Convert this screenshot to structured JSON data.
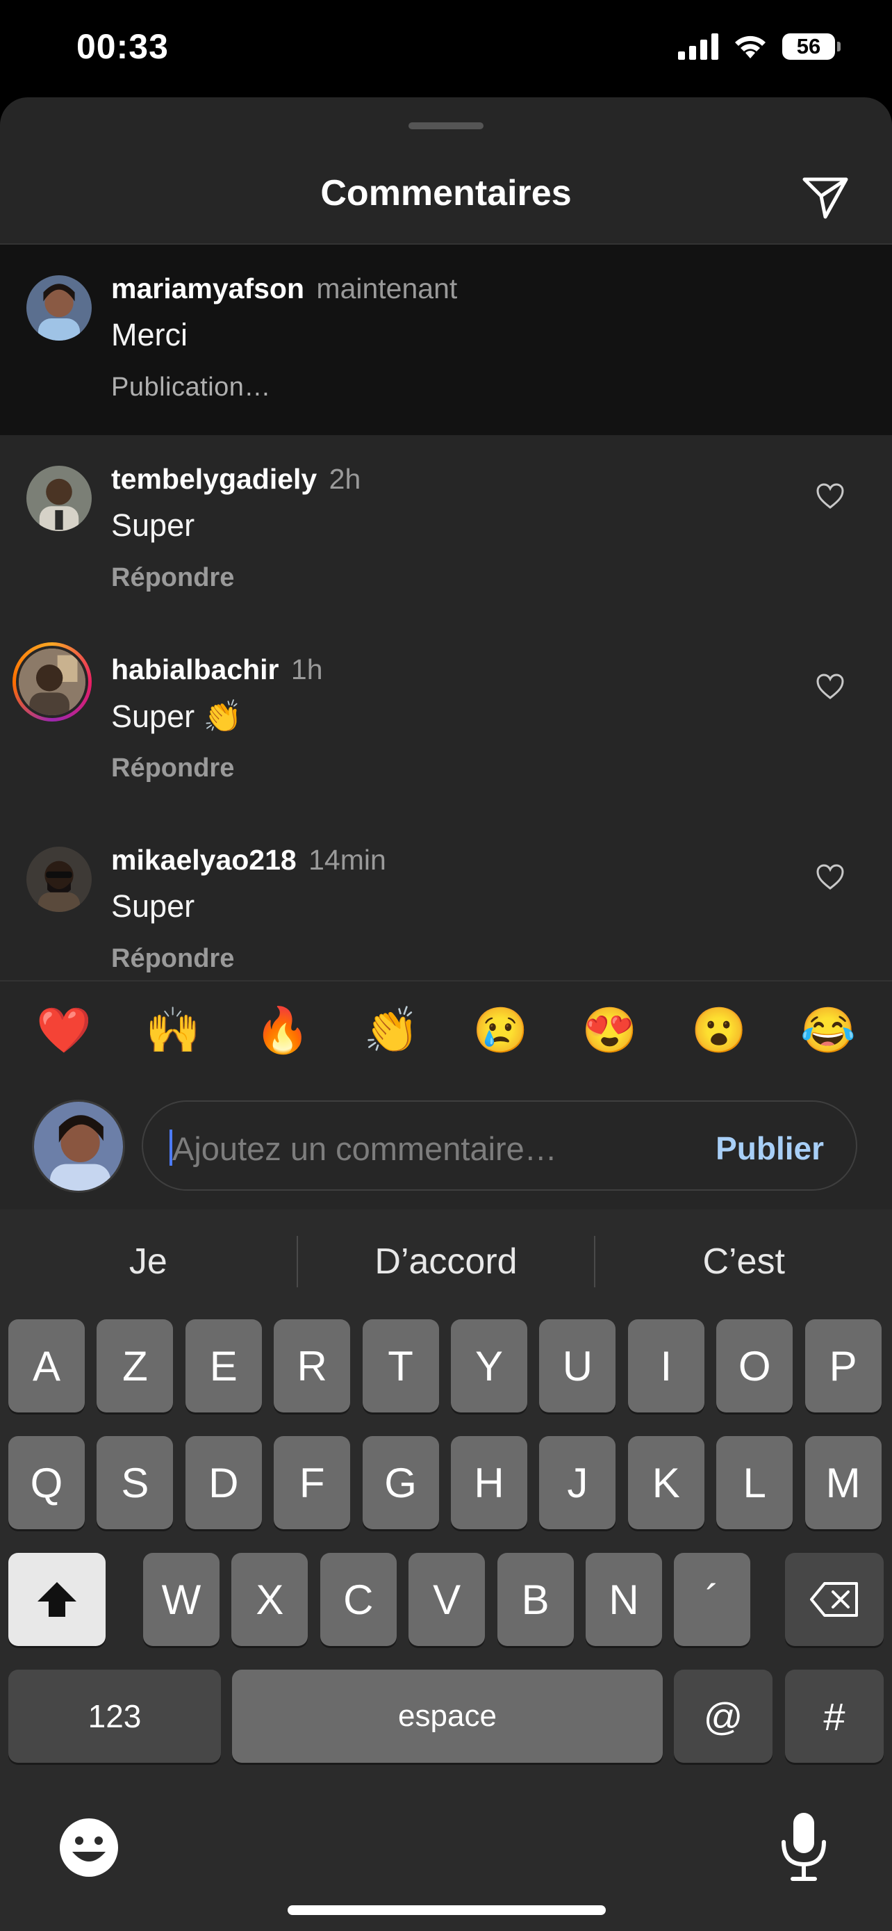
{
  "status_bar": {
    "time": "00:33",
    "battery": "56",
    "icons": [
      "signal-icon",
      "wifi-icon",
      "battery-icon"
    ]
  },
  "sheet": {
    "title": "Commentaires",
    "send_icon": "paper-plane-icon"
  },
  "comments": [
    {
      "username": "mariamyafson",
      "time": "maintenant",
      "text": "Merci",
      "action": "Publication…",
      "highlighted": true
    },
    {
      "username": "tembelygadiely",
      "time": "2h",
      "text": "Super",
      "action": "Répondre"
    },
    {
      "username": "habialbachir",
      "time": "1h",
      "text": "Super 👏",
      "action": "Répondre",
      "story_ring": true
    },
    {
      "username": "mikaelyao218",
      "time": "14min",
      "text": "Super",
      "action": "Répondre"
    }
  ],
  "quick_reactions": [
    "❤️",
    "🙌",
    "🔥",
    "👏",
    "😢",
    "😍",
    "😮",
    "😂"
  ],
  "composer": {
    "placeholder": "Ajoutez un commentaire…",
    "publish_label": "Publier"
  },
  "keyboard": {
    "predictions": [
      "Je",
      "D’accord",
      "C’est"
    ],
    "row1": [
      "A",
      "Z",
      "E",
      "R",
      "T",
      "Y",
      "U",
      "I",
      "O",
      "P"
    ],
    "row2": [
      "Q",
      "S",
      "D",
      "F",
      "G",
      "H",
      "J",
      "K",
      "L",
      "M"
    ],
    "row3": [
      "W",
      "X",
      "C",
      "V",
      "B",
      "N",
      "´"
    ],
    "numbers_label": "123",
    "space_label": "espace",
    "at_label": "@",
    "hash_label": "#"
  },
  "colors": {
    "sheet_bg": "#262626",
    "highlight_bg": "#121212",
    "publish": "#a8cff7",
    "muted": "#9a9a9a"
  }
}
